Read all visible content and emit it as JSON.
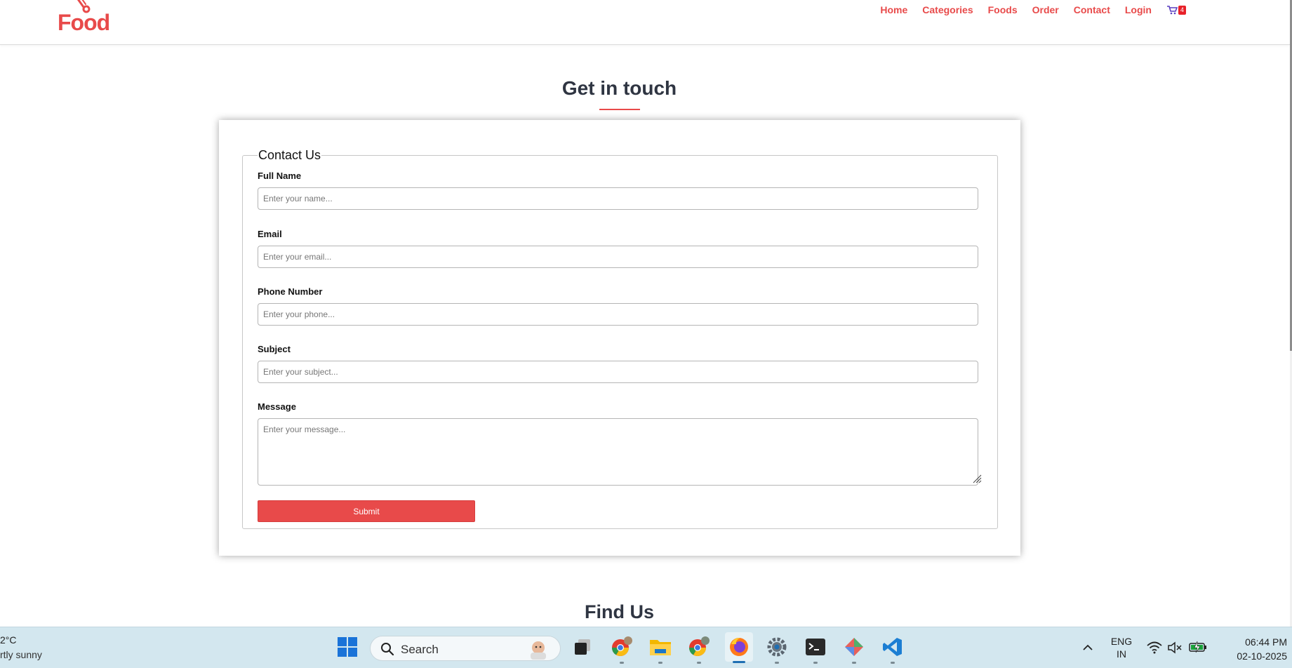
{
  "header": {
    "logo_text": "Food",
    "nav": [
      {
        "label": "Home"
      },
      {
        "label": "Categories"
      },
      {
        "label": "Foods"
      },
      {
        "label": "Order"
      },
      {
        "label": "Contact"
      },
      {
        "label": "Login"
      }
    ],
    "cart_icon": "cart-icon",
    "cart_count": "4"
  },
  "page": {
    "title": "Get in touch",
    "find_title": "Find Us"
  },
  "form": {
    "legend": "Contact Us",
    "full_name_label": "Full Name",
    "full_name_placeholder": "Enter your name...",
    "email_label": "Email",
    "email_placeholder": "Enter your email...",
    "phone_label": "Phone Number",
    "phone_placeholder": "Enter your phone...",
    "subject_label": "Subject",
    "subject_placeholder": "Enter your subject...",
    "message_label": "Message",
    "message_placeholder": "Enter your message...",
    "submit_label": "Submit"
  },
  "taskbar": {
    "weather_temp": "2°C",
    "weather_desc": "rtly sunny",
    "search_label": "Search",
    "lang_top": "ENG",
    "lang_bottom": "IN",
    "time": "06:44 PM",
    "date": "02-10-2025"
  },
  "colors": {
    "accent": "#e84a4a",
    "taskbar": "#d3e7ef"
  }
}
